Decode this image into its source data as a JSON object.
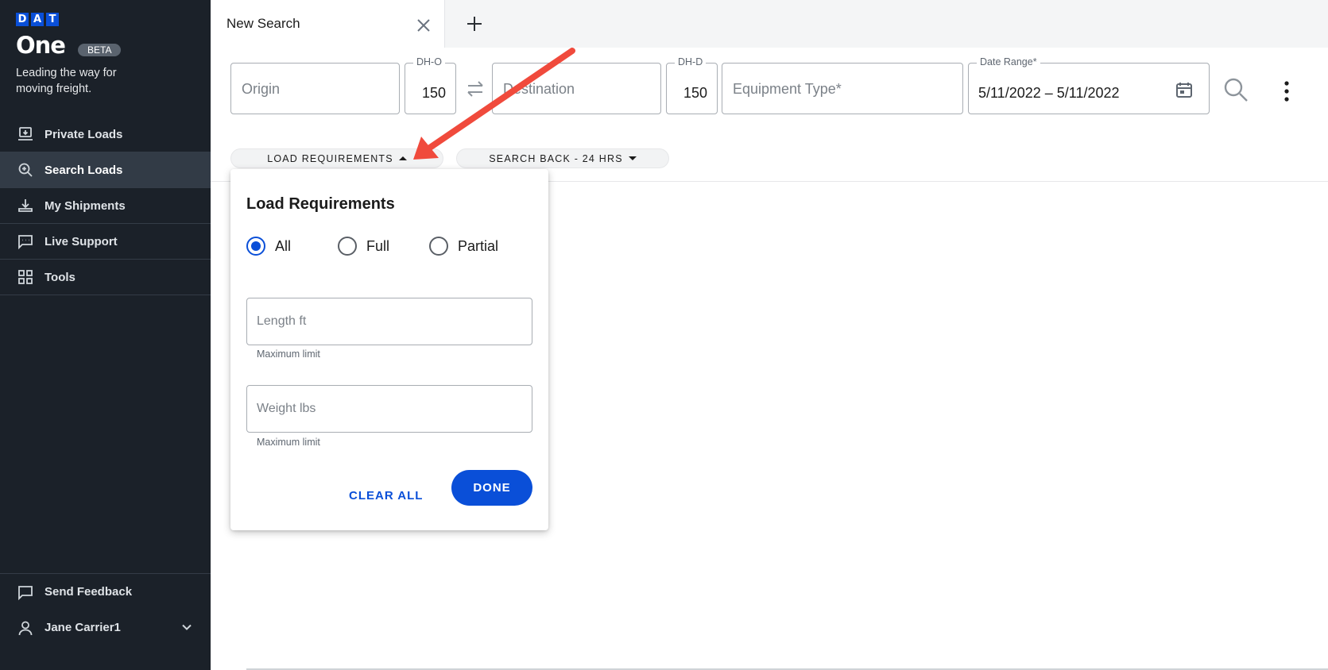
{
  "brand": {
    "letters": [
      "D",
      "A",
      "T"
    ],
    "name": "One",
    "badge": "BETA",
    "tagline": "Leading the way for moving freight.",
    "accent": "#0a4fd8"
  },
  "sidebar": {
    "items": [
      {
        "label": "Private Loads",
        "icon": "private-loads-icon",
        "active": false
      },
      {
        "label": "Search Loads",
        "icon": "search-loads-icon",
        "active": true
      },
      {
        "label": "My Shipments",
        "icon": "shipments-icon",
        "active": false
      },
      {
        "label": "Live Support",
        "icon": "chat-icon",
        "active": false
      },
      {
        "label": "Tools",
        "icon": "tools-icon",
        "active": false
      }
    ],
    "feedback": "Send Feedback",
    "user": "Jane Carrier1"
  },
  "tabs": {
    "active_title": "New Search"
  },
  "search": {
    "origin_placeholder": "Origin",
    "dho_label": "DH-O",
    "dho_value": "150",
    "destination_placeholder": "Destination",
    "dhd_label": "DH-D",
    "dhd_value": "150",
    "equipment_placeholder": "Equipment Type*",
    "date_label": "Date Range*",
    "date_value": "5/11/2022 – 5/11/2022"
  },
  "chips": {
    "load_requirements": "LOAD REQUIREMENTS",
    "search_back": "SEARCH BACK - 24 HRS"
  },
  "popover": {
    "title": "Load Requirements",
    "options": [
      {
        "label": "All",
        "checked": true
      },
      {
        "label": "Full",
        "checked": false
      },
      {
        "label": "Partial",
        "checked": false
      }
    ],
    "length_placeholder": "Length ft",
    "length_helper": "Maximum limit",
    "weight_placeholder": "Weight lbs",
    "weight_helper": "Maximum limit",
    "clear_label": "CLEAR ALL",
    "done_label": "DONE"
  }
}
